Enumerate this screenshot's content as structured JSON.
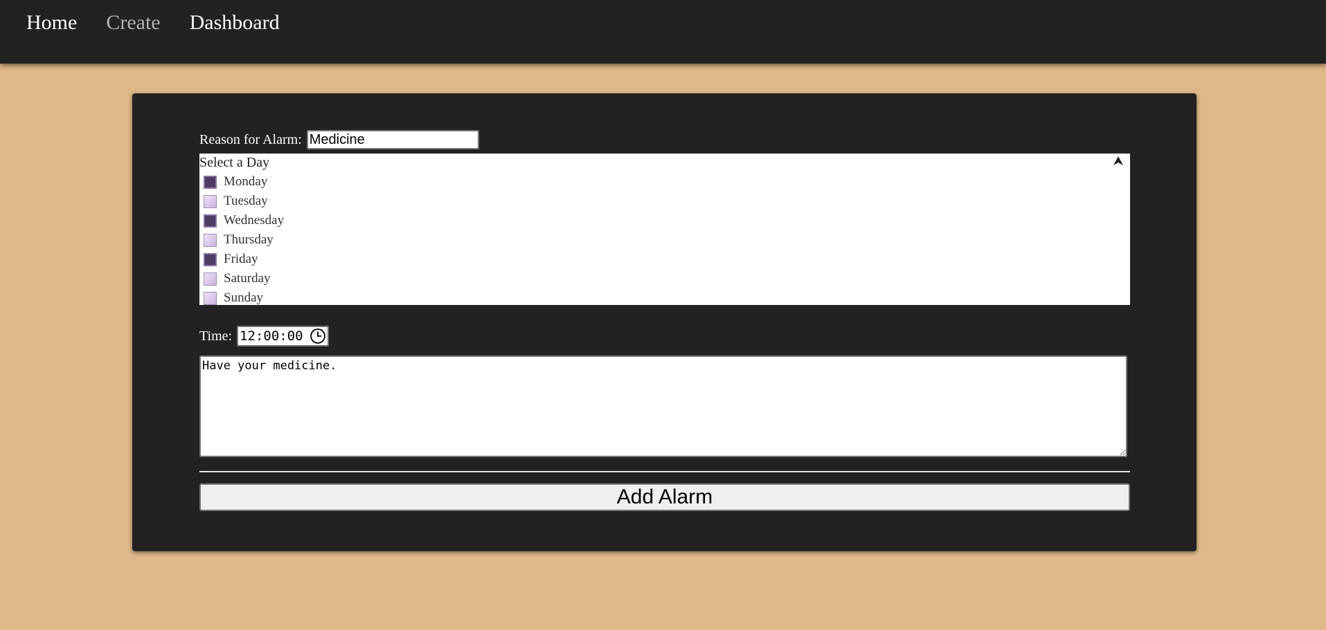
{
  "nav": {
    "items": [
      {
        "label": "Home",
        "active": false
      },
      {
        "label": "Create",
        "active": true
      },
      {
        "label": "Dashboard",
        "active": false
      }
    ]
  },
  "form": {
    "reason_label": "Reason for Alarm:",
    "reason_value": "Medicine",
    "day_select_title": "Select a Day",
    "days": [
      {
        "label": "Monday",
        "checked": true
      },
      {
        "label": "Tuesday",
        "checked": false
      },
      {
        "label": "Wednesday",
        "checked": true
      },
      {
        "label": "Thursday",
        "checked": false
      },
      {
        "label": "Friday",
        "checked": true
      },
      {
        "label": "Saturday",
        "checked": false
      },
      {
        "label": "Sunday",
        "checked": false
      }
    ],
    "time_label": "Time:",
    "time_value": "12:00:00",
    "message_value": "Have your medicine.",
    "submit_label": "Add Alarm"
  },
  "colors": {
    "page_background": "#dfb788",
    "panel_background": "#222222",
    "checkbox_checked": "#4d3b62",
    "checkbox_unchecked": "#d9c6e8"
  },
  "icons": {
    "collapse": "arrow-up-icon",
    "clock": "clock-icon"
  }
}
